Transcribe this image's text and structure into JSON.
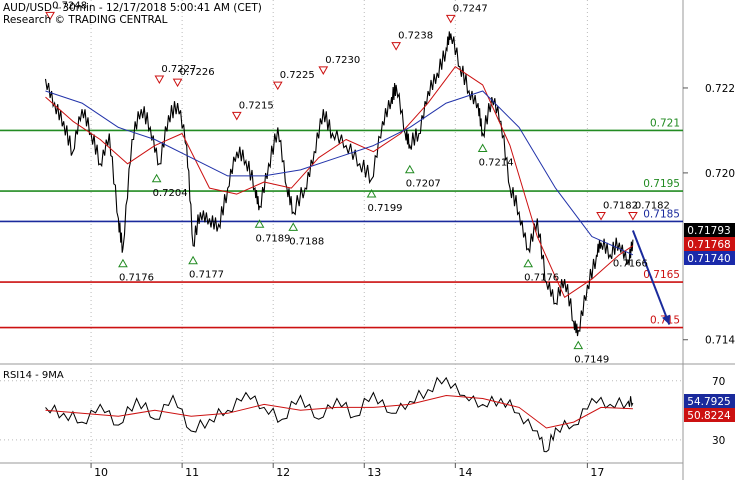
{
  "header": {
    "title": "AUD/USD - 30min - 12/17/2018 5:00:41 AM (CET)",
    "subtitle": "Research © TRADING CENTRAL"
  },
  "colors": {
    "support": "#228b22",
    "pivot": "#1a2a9c",
    "resistance": "#cc1111",
    "price": "#000000",
    "fast_ma": "#cc1111",
    "slow_ma": "#2233aa",
    "forecast_arrow": "#1a2a9c",
    "last_price_badge": "#000000",
    "ma_red_badge": "#cc1111",
    "ma_blue_badge": "#1a2aaa",
    "rsi_badge_blue": "#1a2a9c",
    "rsi_badge_red": "#cc1111"
  },
  "chart_data": [
    {
      "type": "line",
      "panel": "price",
      "y_axis_ticks": [
        "0.7229",
        "0.7201",
        "0.7146"
      ],
      "ylim": [
        0.7138,
        0.7258
      ],
      "x_axis_ticks": [
        "10",
        "11",
        "12",
        "13",
        "14",
        "17"
      ],
      "horizontal_levels": [
        {
          "value": 0.7215,
          "label": "0.721",
          "role": "support"
        },
        {
          "value": 0.7195,
          "label": "0.7195",
          "role": "support"
        },
        {
          "value": 0.7185,
          "label": "0.7185",
          "role": "pivot"
        },
        {
          "value": 0.7165,
          "label": "0.7165",
          "role": "resistance"
        },
        {
          "value": 0.715,
          "label": "0.715",
          "role": "resistance"
        }
      ],
      "price_badges": [
        {
          "label": "0.71793",
          "role": "last_price"
        },
        {
          "label": "0.71768",
          "role": "fast_ma"
        },
        {
          "label": "0.71740",
          "role": "slow_ma"
        }
      ],
      "swing_highs": [
        {
          "x": 0.05,
          "label": "0.7248"
        },
        {
          "x": 1.25,
          "label": "0.7227"
        },
        {
          "x": 1.45,
          "label": "0.7226"
        },
        {
          "x": 2.1,
          "label": "0.7215"
        },
        {
          "x": 2.55,
          "label": "0.7225"
        },
        {
          "x": 3.05,
          "label": "0.7230"
        },
        {
          "x": 3.85,
          "label": "0.7238"
        },
        {
          "x": 4.45,
          "label": "0.7247"
        },
        {
          "x": 6.1,
          "label": "0.7182"
        },
        {
          "x": 6.45,
          "label": "0.7182"
        }
      ],
      "swing_lows": [
        {
          "x": 0.85,
          "label": "0.7176"
        },
        {
          "x": 1.22,
          "label": "0.7204"
        },
        {
          "x": 1.62,
          "label": "0.7177"
        },
        {
          "x": 2.35,
          "label": "0.7189"
        },
        {
          "x": 2.72,
          "label": "0.7188"
        },
        {
          "x": 3.58,
          "label": "0.7199"
        },
        {
          "x": 4.0,
          "label": "0.7207"
        },
        {
          "x": 4.8,
          "label": "0.7214"
        },
        {
          "x": 5.3,
          "label": "0.7176"
        },
        {
          "x": 5.85,
          "label": "0.7149"
        }
      ],
      "forecast": {
        "label": "0.7166",
        "from": [
          6.45,
          0.7182
        ],
        "to": [
          6.85,
          0.7151
        ]
      },
      "series": [
        {
          "role": "price",
          "x": [
            0.0,
            0.1,
            0.2,
            0.3,
            0.4,
            0.5,
            0.6,
            0.7,
            0.8,
            0.85,
            0.95,
            1.05,
            1.15,
            1.25,
            1.35,
            1.45,
            1.55,
            1.62,
            1.7,
            1.8,
            1.9,
            2.0,
            2.1,
            2.2,
            2.3,
            2.35,
            2.45,
            2.55,
            2.65,
            2.72,
            2.85,
            2.95,
            3.05,
            3.15,
            3.3,
            3.45,
            3.58,
            3.7,
            3.8,
            3.85,
            3.95,
            4.0,
            4.1,
            4.2,
            4.3,
            4.4,
            4.45,
            4.55,
            4.65,
            4.75,
            4.8,
            4.9,
            5.0,
            5.1,
            5.2,
            5.3,
            5.4,
            5.5,
            5.6,
            5.7,
            5.8,
            5.85,
            5.95,
            6.05,
            6.1,
            6.2,
            6.3,
            6.4,
            6.45
          ],
          "y": [
            0.7232,
            0.7224,
            0.7218,
            0.7208,
            0.7222,
            0.7214,
            0.7204,
            0.7214,
            0.7186,
            0.7176,
            0.7212,
            0.7222,
            0.7216,
            0.7204,
            0.722,
            0.7224,
            0.721,
            0.7177,
            0.7188,
            0.7186,
            0.7184,
            0.7196,
            0.7208,
            0.7205,
            0.7196,
            0.719,
            0.7204,
            0.7216,
            0.7196,
            0.7188,
            0.7196,
            0.7208,
            0.7222,
            0.7214,
            0.721,
            0.7204,
            0.7199,
            0.7218,
            0.7226,
            0.723,
            0.7214,
            0.721,
            0.7214,
            0.7228,
            0.7234,
            0.7242,
            0.7247,
            0.7236,
            0.7228,
            0.7224,
            0.7214,
            0.7226,
            0.7218,
            0.7196,
            0.7188,
            0.7176,
            0.7186,
            0.7165,
            0.7158,
            0.7166,
            0.7152,
            0.7149,
            0.7164,
            0.7174,
            0.7178,
            0.7174,
            0.7178,
            0.7172,
            0.7179
          ]
        },
        {
          "role": "fast_ma",
          "x": [
            0.0,
            0.3,
            0.6,
            0.9,
            1.2,
            1.5,
            1.8,
            2.1,
            2.4,
            2.7,
            3.0,
            3.3,
            3.6,
            3.9,
            4.2,
            4.5,
            4.8,
            5.1,
            5.4,
            5.7,
            6.0,
            6.3,
            6.45
          ],
          "y": [
            0.7226,
            0.7218,
            0.7212,
            0.7204,
            0.721,
            0.7214,
            0.7196,
            0.7194,
            0.7198,
            0.7196,
            0.7206,
            0.7212,
            0.7208,
            0.7214,
            0.7224,
            0.7236,
            0.723,
            0.721,
            0.718,
            0.716,
            0.7166,
            0.7174,
            0.7177
          ]
        },
        {
          "role": "slow_ma",
          "x": [
            0.0,
            0.4,
            0.8,
            1.2,
            1.6,
            2.0,
            2.4,
            2.8,
            3.2,
            3.6,
            4.0,
            4.4,
            4.8,
            5.2,
            5.6,
            6.0,
            6.3,
            6.45
          ],
          "y": [
            0.7228,
            0.7224,
            0.7216,
            0.7212,
            0.7206,
            0.72,
            0.72,
            0.7202,
            0.7206,
            0.721,
            0.7216,
            0.7224,
            0.7228,
            0.7216,
            0.7196,
            0.718,
            0.7176,
            0.7174
          ]
        }
      ]
    },
    {
      "type": "line",
      "panel": "indicator",
      "title": "RSI14 - 9MA",
      "y_axis_ticks": [
        "70",
        "30"
      ],
      "ylim": [
        15,
        80
      ],
      "badges": [
        {
          "label": "54.7925",
          "role": "rsi"
        },
        {
          "label": "50.8224",
          "role": "rsi_ma"
        }
      ],
      "series": [
        {
          "role": "rsi",
          "x": [
            0.0,
            0.2,
            0.4,
            0.6,
            0.8,
            1.0,
            1.2,
            1.4,
            1.6,
            1.8,
            2.0,
            2.2,
            2.4,
            2.6,
            2.8,
            3.0,
            3.2,
            3.4,
            3.6,
            3.8,
            4.0,
            4.2,
            4.4,
            4.6,
            4.8,
            5.0,
            5.2,
            5.4,
            5.5,
            5.6,
            5.8,
            6.0,
            6.2,
            6.4,
            6.45
          ],
          "y": [
            52,
            48,
            42,
            54,
            40,
            58,
            44,
            60,
            36,
            44,
            50,
            62,
            52,
            44,
            60,
            44,
            58,
            46,
            62,
            48,
            56,
            64,
            72,
            60,
            54,
            58,
            48,
            36,
            22,
            38,
            40,
            58,
            54,
            56,
            55
          ]
        },
        {
          "role": "rsi_ma",
          "x": [
            0.0,
            0.4,
            0.8,
            1.2,
            1.6,
            2.0,
            2.4,
            2.8,
            3.2,
            3.6,
            4.0,
            4.4,
            4.8,
            5.2,
            5.5,
            5.8,
            6.1,
            6.45
          ],
          "y": [
            50,
            48,
            46,
            50,
            46,
            48,
            54,
            50,
            52,
            52,
            54,
            60,
            58,
            52,
            38,
            42,
            52,
            51
          ]
        }
      ]
    }
  ]
}
